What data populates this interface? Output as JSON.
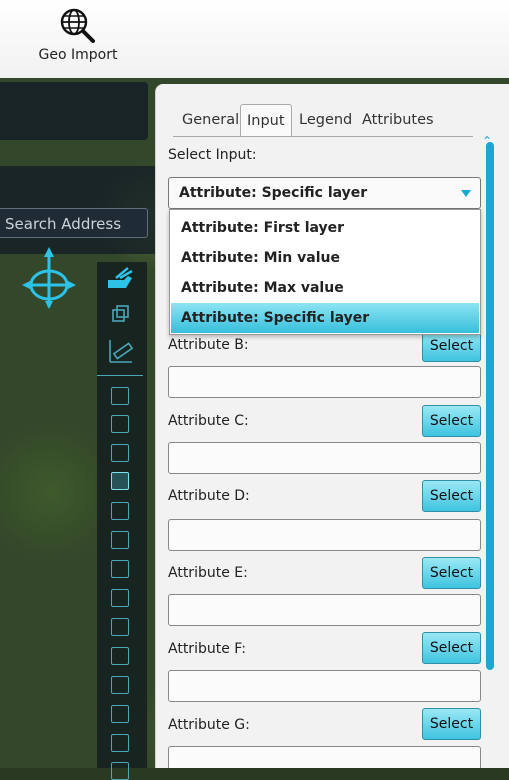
{
  "toolbar": {
    "geo_import_label": "Geo Import",
    "geo_import_icon": "globe-search-icon"
  },
  "map": {
    "search_placeholder": "Search Address"
  },
  "panel": {
    "tabs": [
      {
        "label": "General",
        "active": false
      },
      {
        "label": "Input",
        "active": true
      },
      {
        "label": "Legend",
        "active": false
      },
      {
        "label": "Attributes",
        "active": false
      }
    ],
    "select_input_label": "Select Input:",
    "select_value": "Attribute: Specific layer",
    "options": [
      "Attribute: First layer",
      "Attribute: Min value",
      "Attribute: Max value",
      "Attribute: Specific layer"
    ],
    "selected_option_index": 3,
    "attributes": [
      {
        "label": "Attribute B:",
        "button": "Select",
        "value": ""
      },
      {
        "label": "Attribute C:",
        "button": "Select",
        "value": ""
      },
      {
        "label": "Attribute D:",
        "button": "Select",
        "value": ""
      },
      {
        "label": "Attribute E:",
        "button": "Select",
        "value": ""
      },
      {
        "label": "Attribute F:",
        "button": "Select",
        "value": ""
      },
      {
        "label": "Attribute G:",
        "button": "Select",
        "value": ""
      }
    ]
  },
  "colors": {
    "accent": "#1aa8cf",
    "selected_option": "#36bfdc",
    "button": "#3fc4e0"
  }
}
